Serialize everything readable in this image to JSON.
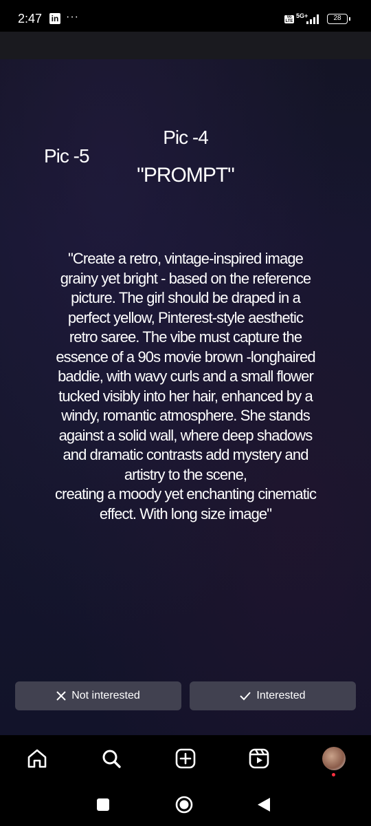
{
  "status_bar": {
    "time": "2:47",
    "linkedin_label": "in",
    "more_label": "···",
    "volte_label": "Vo LTE",
    "network_label": "5G+",
    "battery_level": "28"
  },
  "post": {
    "pic_4_label": "Pic -4",
    "pic_5_label": "Pic -5",
    "prompt_heading": "\"PROMPT\"",
    "prompt_lines": [
      "\"Create a retro, vintage-inspired image",
      "grainy yet bright - based on the reference",
      "picture. The girl should be draped in a",
      "perfect yellow, Pinterest-style aesthetic",
      "retro saree. The vibe must capture the",
      "essence of a 90s movie brown -longhaired",
      "baddie, with wavy curls and a small flower",
      "tucked visibly into her hair, enhanced by a",
      "windy, romantic atmosphere. She stands",
      "against a solid wall, where deep shadows",
      "and dramatic contrasts add mystery and",
      "artistry to the scene,",
      "creating a moody yet enchanting cinematic",
      "effect. With long size image\""
    ]
  },
  "actions": {
    "not_interested_label": "Not interested",
    "not_interested_icon": "close-icon",
    "interested_label": "Interested",
    "interested_icon": "check-icon"
  },
  "bottom_nav": {
    "items": [
      "home-icon",
      "search-icon",
      "create-icon",
      "reels-icon",
      "profile-avatar"
    ],
    "notification_dot_color": "#ff3040"
  },
  "system_nav": {
    "items": [
      "recents-button",
      "home-button",
      "back-button"
    ]
  },
  "colors": {
    "background": "#000000",
    "button_bg": "#414150",
    "text": "#ffffff"
  }
}
